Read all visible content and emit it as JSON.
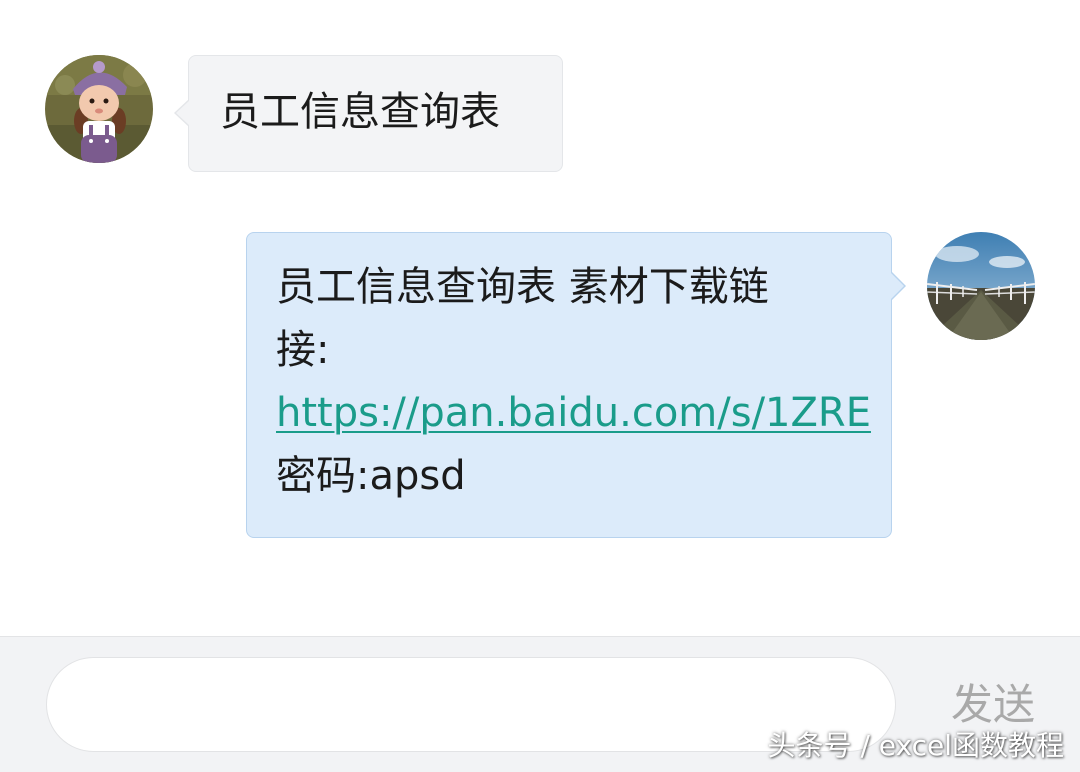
{
  "conversation": {
    "incoming_message": {
      "avatar_icon": "girl-figurine-avatar",
      "text": "员工信息查询表"
    },
    "outgoing_message": {
      "avatar_icon": "bridge-landscape-avatar",
      "line1": "员工信息查询表 素材下载链",
      "line2": "接:",
      "link": "https://pan.baidu.com/s/1ZRE",
      "line4": "密码:apsd"
    }
  },
  "input_bar": {
    "input_value": "",
    "input_placeholder": "",
    "send_label": "发送"
  },
  "watermark": "头条号 / excel函数教程",
  "colors": {
    "incoming_bubble": "#f3f4f6",
    "outgoing_bubble": "#dcebfa",
    "outgoing_border": "#b8d3ee",
    "link": "#1a9c8a",
    "send_text": "#a9a9a9",
    "input_bar_bg": "#f2f3f5"
  }
}
